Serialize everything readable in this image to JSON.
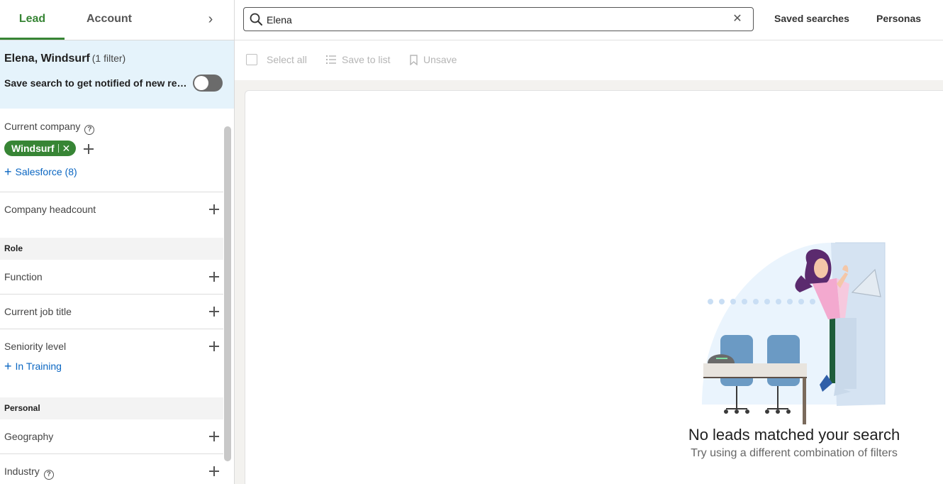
{
  "tabs": {
    "lead": "Lead",
    "account": "Account",
    "chevron": "›"
  },
  "banner": {
    "title": "Elena, Windsurf",
    "filter_count": "(1 filter)",
    "save_text": "Save search to get notified of new results"
  },
  "filters": {
    "current_company": {
      "label": "Current company",
      "help": "?",
      "chip": "Windsurf",
      "chip_remove": "✕",
      "suggestion": "Salesforce (8)"
    },
    "company_headcount": {
      "label": "Company headcount"
    },
    "role_section": "Role",
    "function": {
      "label": "Function"
    },
    "current_job_title": {
      "label": "Current job title"
    },
    "seniority_level": {
      "label": "Seniority level",
      "suggestion": "In Training"
    },
    "personal_section": "Personal",
    "geography": {
      "label": "Geography"
    },
    "industry": {
      "label": "Industry",
      "help": "?"
    }
  },
  "search": {
    "value": "Elena",
    "clear": "✕"
  },
  "top_buttons": {
    "saved_searches": "Saved searches",
    "personas": "Personas"
  },
  "bulk_actions": {
    "select_all": "Select all",
    "save_to_list": "Save to list",
    "unsave": "Unsave"
  },
  "empty_state": {
    "title": "No leads matched your search",
    "subtitle": "Try using a different combination of filters"
  },
  "colors": {
    "brand_green": "#378535",
    "link_blue": "#0a66c2",
    "banner_bg": "#e5f3fb"
  }
}
